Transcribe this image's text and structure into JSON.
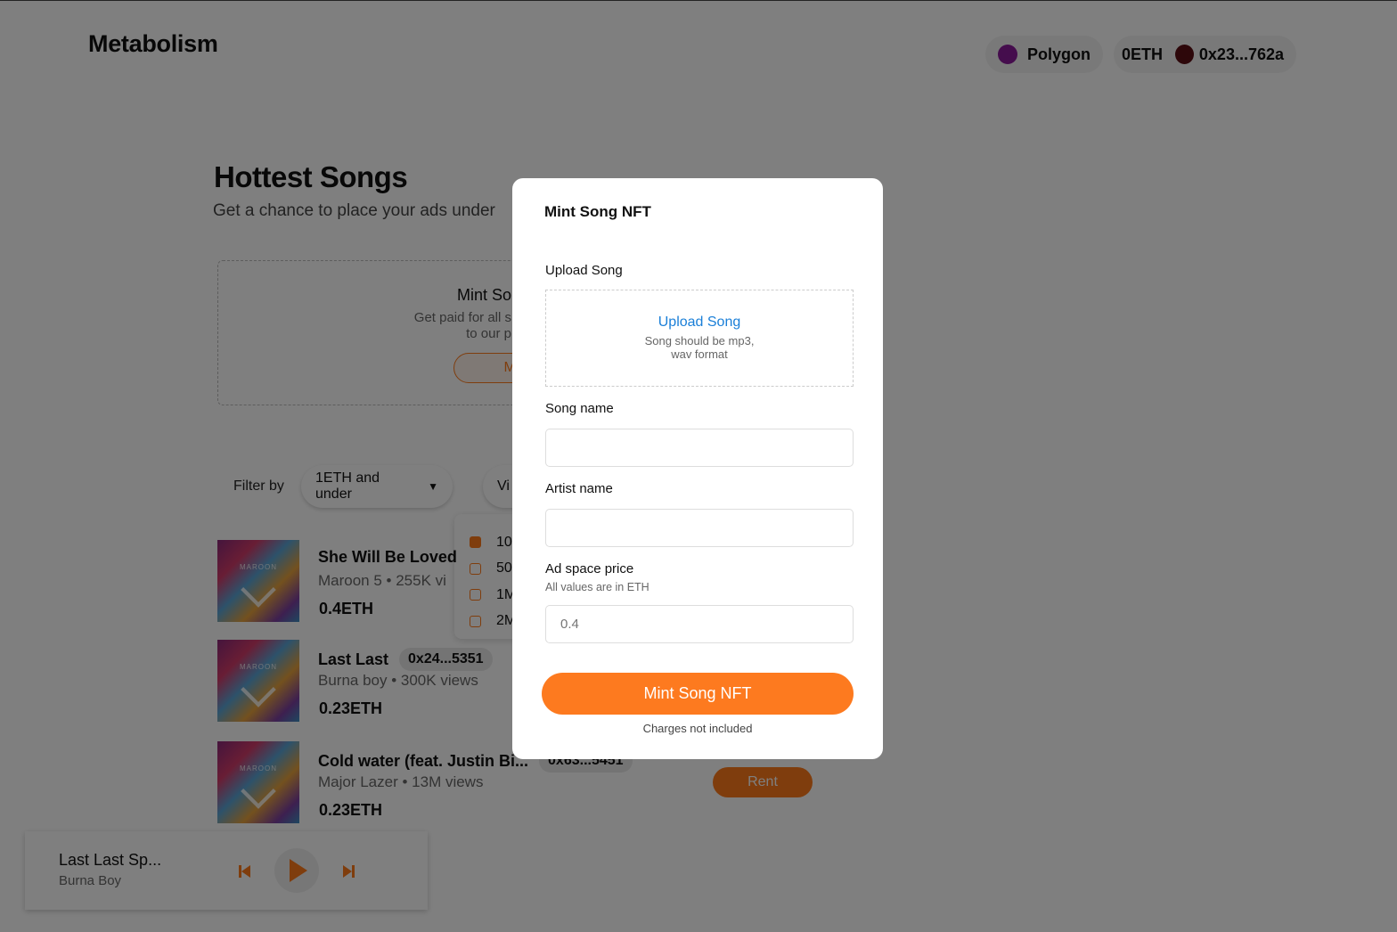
{
  "header": {
    "logo": "Metabolism",
    "network": "Polygon",
    "network_color": "#8a1a9b",
    "balance": "0ETH",
    "wallet": "0x23...762a",
    "wallet_color": "#5a0f14"
  },
  "hero": {
    "title": "Hottest Songs",
    "subtitle": "Get a chance to place your ads under"
  },
  "mint_card": {
    "title": "Mint So",
    "description_line1": "Get paid for all s",
    "description_line2": "to our p",
    "button": "Mi"
  },
  "filters": {
    "label": "Filter by",
    "price_filter": "1ETH and under",
    "views_filter": "Vi",
    "views_options": [
      {
        "label": "10",
        "checked": true
      },
      {
        "label": "50",
        "checked": false
      },
      {
        "label": "1M",
        "checked": false
      },
      {
        "label": "2M",
        "checked": false
      }
    ]
  },
  "songs": [
    {
      "title": "She Will Be Loved",
      "address": "",
      "meta": "Maroon 5 • 255K vi",
      "price": "0.4ETH",
      "art_text": "MAROON"
    },
    {
      "title": "Last Last",
      "address": "0x24...5351",
      "meta": "Burna boy • 300K views",
      "price": "0.23ETH",
      "art_text": "MAROON"
    },
    {
      "title": "Cold water (feat. Justin Bi...",
      "address": "0x63...5451",
      "meta": "Major Lazer • 13M views",
      "price": "0.23ETH",
      "art_text": "MAROON"
    }
  ],
  "rent_label": "Rent",
  "player": {
    "title": "Last Last Sp...",
    "artist": "Burna Boy"
  },
  "accent": "#fd7a1f",
  "modal": {
    "title": "Mint Song NFT",
    "upload_label": "Upload Song",
    "upload_link": "Upload Song",
    "upload_hint_line1": "Song should be mp3,",
    "upload_hint_line2": "wav format",
    "song_name_label": "Song name",
    "song_name_value": "",
    "artist_name_label": "Artist name",
    "artist_name_value": "",
    "price_label": "Ad space price",
    "price_hint": "All values are in ETH",
    "price_placeholder": "0.4",
    "submit": "Mint Song NFT",
    "charges_note": "Charges not included"
  }
}
